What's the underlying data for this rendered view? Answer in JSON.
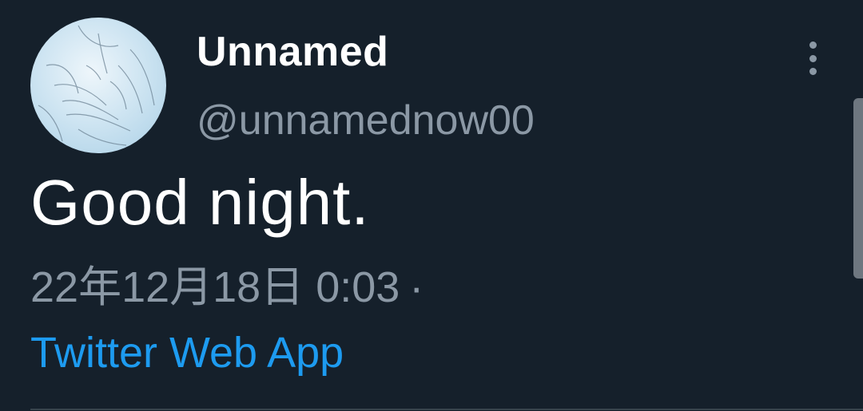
{
  "tweet": {
    "author": {
      "display_name": "Unnamed",
      "handle": "@unnamednow00",
      "avatar_icon": "avatar-illustration"
    },
    "text": "Good night.",
    "timestamp": "22年12月18日 0:03",
    "separator": "·",
    "source": "Twitter Web App",
    "more_icon": "vertical-ellipsis-icon"
  },
  "colors": {
    "background": "#15202b",
    "primary_text": "#ffffff",
    "secondary_text": "#8b98a5",
    "accent": "#1d9bf0"
  }
}
